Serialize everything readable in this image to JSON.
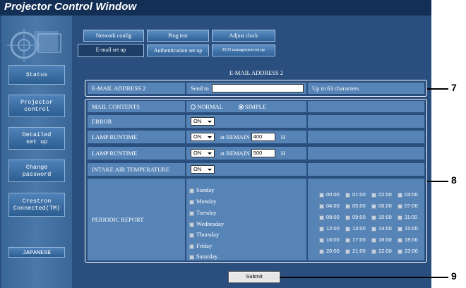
{
  "window": {
    "title": "Projector Control Window"
  },
  "sidebar": {
    "items": [
      {
        "label": "Status"
      },
      {
        "label": "Projector\ncontrol"
      },
      {
        "label": "Detailed\nset up"
      },
      {
        "label": "Change\npassword"
      },
      {
        "label": "Crestron\nConnected(TM)"
      }
    ],
    "language": "JAPANESE"
  },
  "tabs": {
    "row1": [
      "Network config",
      "Ping test",
      "Adjust clock"
    ],
    "row2": [
      "E-mail set up",
      "Authentication set up",
      "ECO management set up"
    ],
    "active": "E-mail set up"
  },
  "page_title": "E-MAIL ADDRESS 2",
  "address_row": {
    "label": "E-MAIL ADDRESS 2",
    "send_to": "Send to",
    "value": "",
    "hint": "Up to 63 characters"
  },
  "mail_contents": {
    "label": "MAIL CONTENTS",
    "option_normal": "NORMAL",
    "option_simple": "SIMPLE",
    "selected": "SIMPLE"
  },
  "settings": [
    {
      "label": "ERROR",
      "select": "ON"
    },
    {
      "label": "LAMP RUNTIME",
      "select": "ON",
      "remain_label": "at REMAIN",
      "remain_value": "400",
      "unit": "H"
    },
    {
      "label": "LAMP RUNTIME",
      "select": "ON",
      "remain_label": "at REMAIN",
      "remain_value": "500",
      "unit": "H"
    },
    {
      "label": "INTAKE AIR TEMPERATURE",
      "select": "ON"
    }
  ],
  "periodic": {
    "label": "PERIODIC REPORT",
    "days": [
      "Sunday",
      "Monday",
      "Tuesday",
      "Wednesday",
      "Thursday",
      "Friday",
      "Saturday"
    ],
    "hours": [
      "00:00",
      "01:00",
      "02:00",
      "03:00",
      "04:00",
      "05:00",
      "06:00",
      "07:00",
      "08:00",
      "09:00",
      "10:00",
      "11:00",
      "12:00",
      "13:00",
      "14:00",
      "15:00",
      "16:00",
      "17:00",
      "18:00",
      "19:00",
      "20:00",
      "21:00",
      "22:00",
      "23:00"
    ]
  },
  "submit_label": "Submit",
  "callouts": [
    "7",
    "8",
    "9"
  ],
  "colors": {
    "window_bg": "#2a4f7e",
    "titlebar": "#142f55",
    "cell_bg": "#5784b6"
  }
}
